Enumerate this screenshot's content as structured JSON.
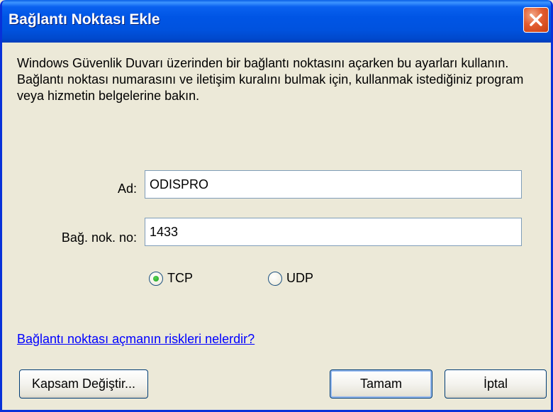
{
  "window": {
    "title": "Bağlantı Noktası Ekle"
  },
  "description": "Windows Güvenlik Duvarı üzerinden bir bağlantı noktasını açarken bu ayarları kullanın. Bağlantı noktası numarasını ve iletişim kuralını bulmak için, kullanmak istediğiniz program veya hizmetin belgelerine bakın.",
  "form": {
    "name_label": "Ad:",
    "name_value": "ODISPRO",
    "port_label": "Bağ. nok. no:",
    "port_value": "1433",
    "protocol_tcp_label": "TCP",
    "protocol_udp_label": "UDP",
    "selected_protocol": "TCP"
  },
  "risk_link": "Bağlantı noktası açmanın riskleri nelerdir?",
  "buttons": {
    "change_scope": "Kapsam Değiştir...",
    "ok": "Tamam",
    "cancel": "İptal"
  },
  "icons": {
    "close": "close-icon",
    "radio_selected": "radio-selected-icon",
    "radio_unselected": "radio-unselected-icon"
  },
  "colors": {
    "titlebar": "#0055e5",
    "window_bg": "#ece9d8",
    "close_button": "#e25c2f",
    "link": "#0000ff"
  }
}
